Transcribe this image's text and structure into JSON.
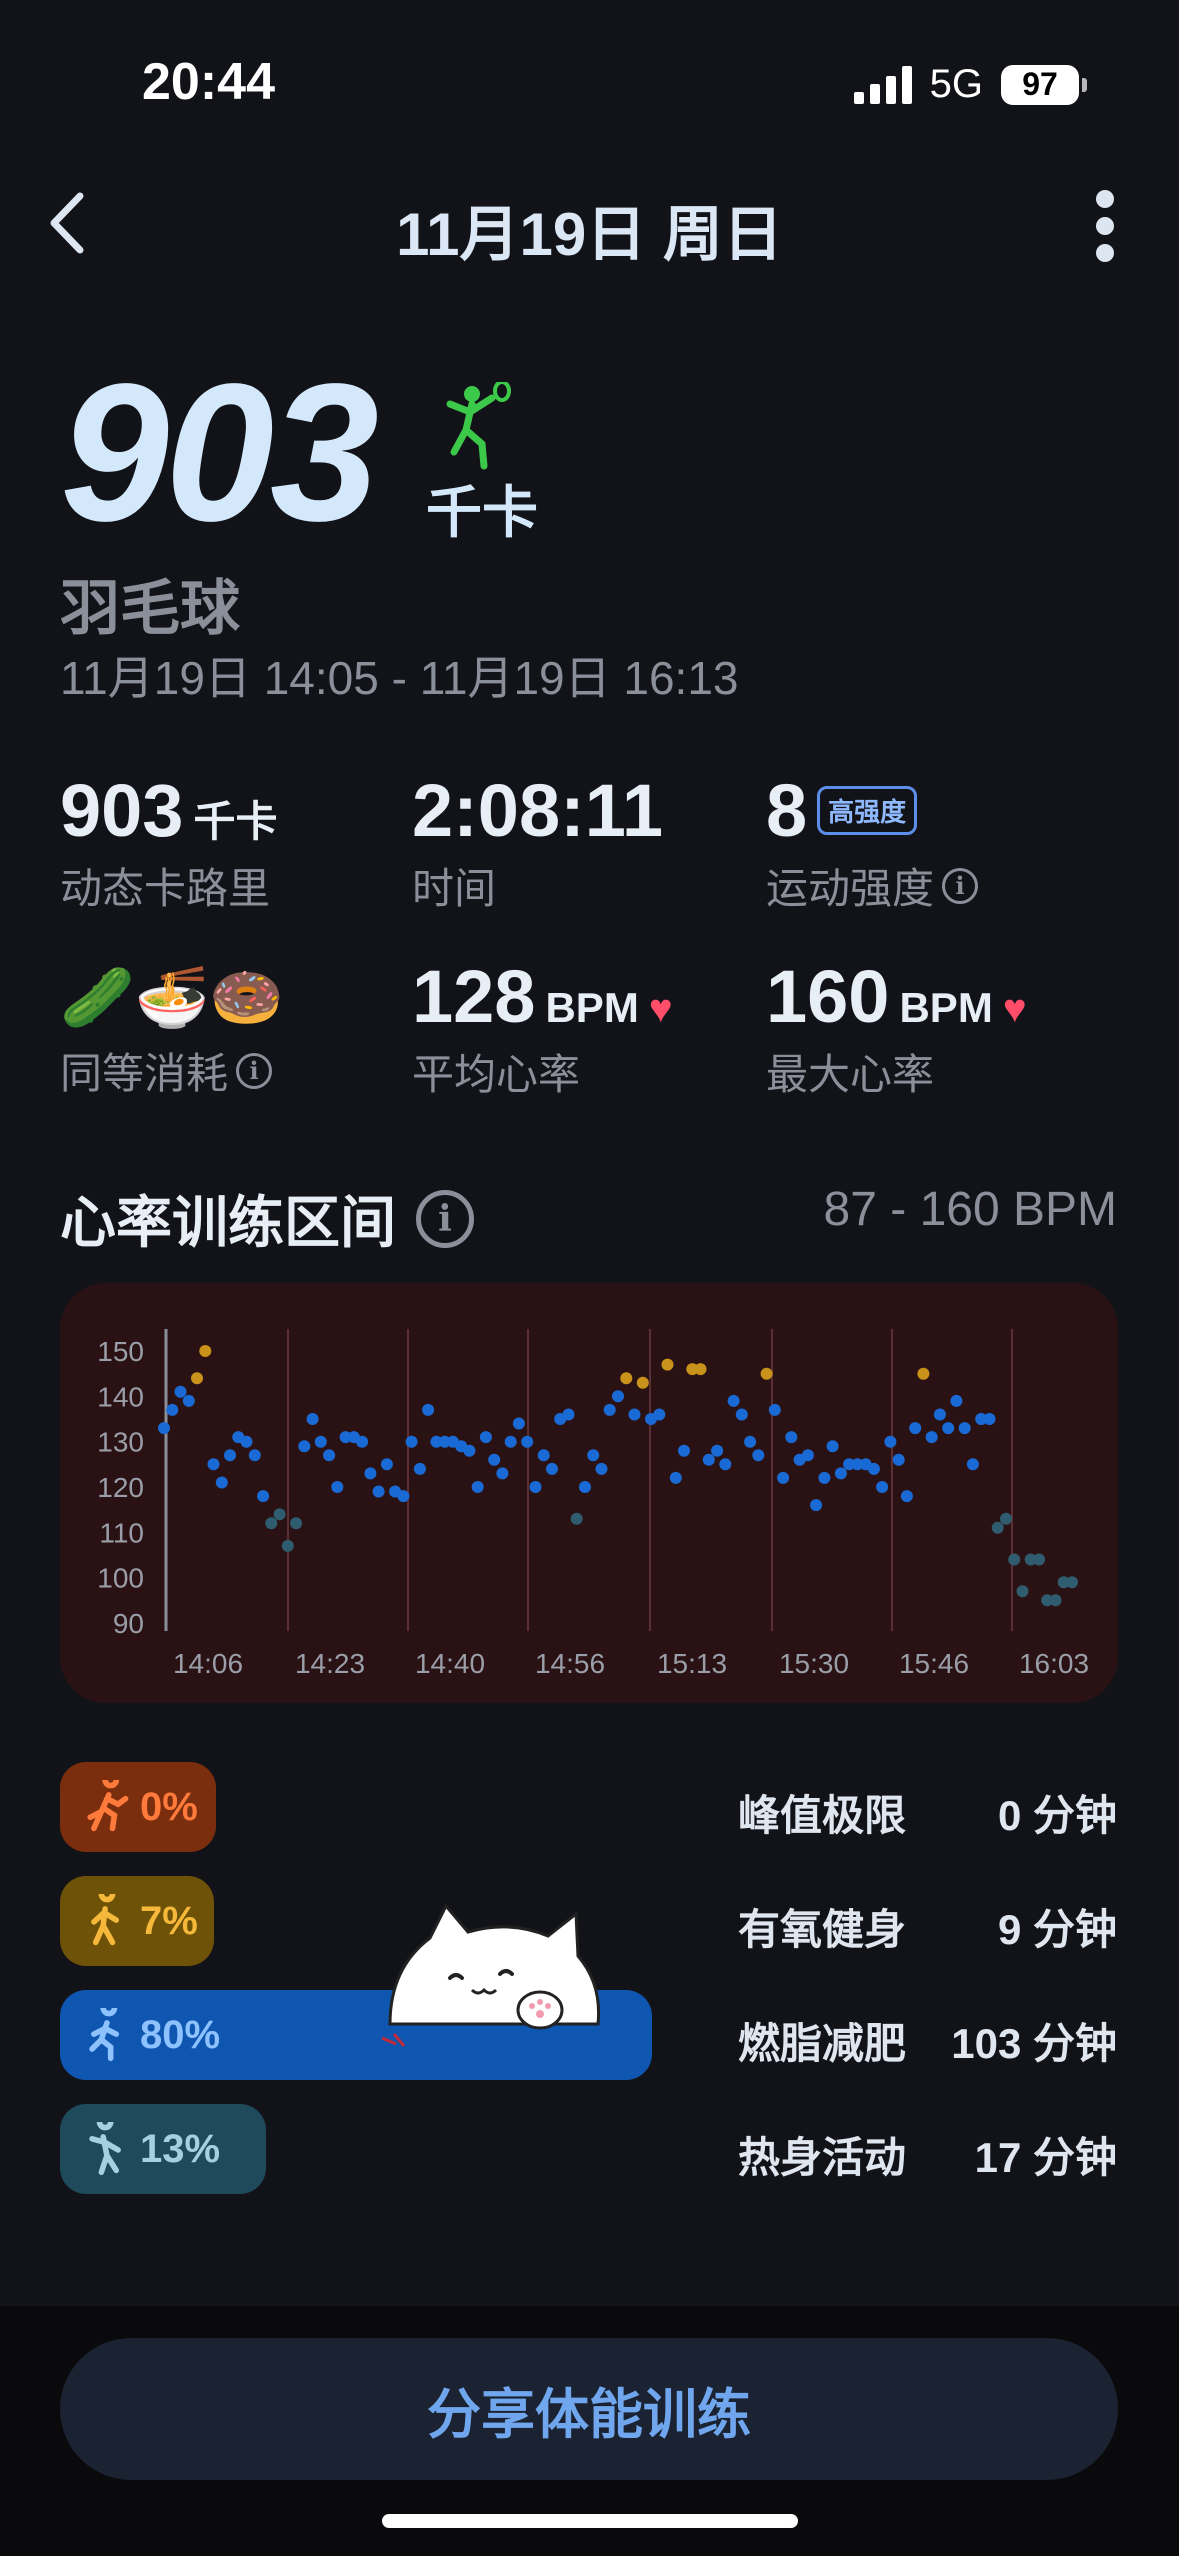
{
  "status": {
    "time": "20:44",
    "network": "5G",
    "battery": "97"
  },
  "nav": {
    "title": "11月19日 周日"
  },
  "hero": {
    "calories": "903",
    "unit": "千卡",
    "sport": "羽毛球",
    "time_range": "11月19日 14:05 - 11月19日 16:13"
  },
  "stats": {
    "active_cal": {
      "value": "903",
      "unit": "千卡",
      "label": "动态卡路里"
    },
    "duration": {
      "value": "2:08:11",
      "label": "时间"
    },
    "intensity": {
      "value": "8",
      "badge": "高强度",
      "label": "运动强度"
    },
    "equivalent": {
      "emojis": "🥒🍜🍩",
      "label": "同等消耗"
    },
    "avg_hr": {
      "value": "128",
      "unit": "BPM",
      "label": "平均心率"
    },
    "max_hr": {
      "value": "160",
      "unit": "BPM",
      "label": "最大心率"
    }
  },
  "zones": {
    "title": "心率训练区间",
    "range": "87 - 160 BPM",
    "items": [
      {
        "pct": "0%",
        "label": "峰值极限",
        "value": "0 分钟",
        "bg": "#7a2e0e",
        "fg": "#ff7a3b",
        "fraction": 0.0
      },
      {
        "pct": "7%",
        "label": "有氧健身",
        "value": "9 分钟",
        "bg": "#6e5208",
        "fg": "#f5b83a",
        "fraction": 0.07
      },
      {
        "pct": "80%",
        "label": "燃脂减肥",
        "value": "103 分钟",
        "bg": "#0e56b0",
        "fg": "#8ec2ff",
        "fraction": 0.8
      },
      {
        "pct": "13%",
        "label": "热身活动",
        "value": "17 分钟",
        "bg": "#1f4a5c",
        "fg": "#a6cfe0",
        "fraction": 0.13
      }
    ]
  },
  "chart_data": {
    "type": "scatter",
    "title": "",
    "xlabel": "",
    "ylabel": "",
    "ylim": [
      90,
      150
    ],
    "y_ticks": [
      "150",
      "140",
      "130",
      "120",
      "110",
      "100",
      "90"
    ],
    "x_ticks": [
      "14:06",
      "14:23",
      "14:40",
      "14:56",
      "15:13",
      "15:30",
      "15:46",
      "16:03"
    ],
    "x_range_minutes": [
      0,
      128
    ],
    "series": [
      {
        "points": [
          [
            0,
            133
          ],
          [
            1,
            137
          ],
          [
            2,
            141
          ],
          [
            3,
            139
          ],
          [
            4,
            144
          ],
          [
            5,
            150
          ],
          [
            7,
            125
          ],
          [
            8,
            121
          ],
          [
            9,
            127
          ],
          [
            10,
            131
          ],
          [
            11,
            130
          ],
          [
            12,
            127
          ],
          [
            13,
            118
          ],
          [
            14,
            112
          ],
          [
            15,
            114
          ],
          [
            16,
            107
          ],
          [
            17,
            112
          ],
          [
            18,
            129
          ],
          [
            19,
            135
          ],
          [
            20,
            130
          ],
          [
            21,
            127
          ],
          [
            22,
            120
          ],
          [
            23,
            131
          ],
          [
            24,
            131
          ],
          [
            25,
            130
          ],
          [
            26,
            123
          ],
          [
            27,
            119
          ],
          [
            28,
            125
          ],
          [
            29,
            119
          ],
          [
            30,
            118
          ],
          [
            31,
            130
          ],
          [
            32,
            124
          ],
          [
            33,
            137
          ],
          [
            34,
            130
          ],
          [
            35,
            130
          ],
          [
            36,
            130
          ],
          [
            37,
            129
          ],
          [
            38,
            128
          ],
          [
            39,
            120
          ],
          [
            40,
            131
          ],
          [
            41,
            126
          ],
          [
            42,
            123
          ],
          [
            43,
            130
          ],
          [
            44,
            134
          ],
          [
            45,
            130
          ],
          [
            46,
            120
          ],
          [
            47,
            127
          ],
          [
            48,
            124
          ],
          [
            49,
            135
          ],
          [
            50,
            136
          ],
          [
            51,
            113
          ],
          [
            52,
            120
          ],
          [
            53,
            127
          ],
          [
            54,
            124
          ],
          [
            55,
            137
          ],
          [
            56,
            140
          ],
          [
            57,
            144
          ],
          [
            58,
            136
          ],
          [
            59,
            143
          ],
          [
            60,
            135
          ],
          [
            61,
            136
          ],
          [
            62,
            147
          ],
          [
            63,
            122
          ],
          [
            64,
            128
          ],
          [
            65,
            146
          ],
          [
            66,
            146
          ],
          [
            67,
            126
          ],
          [
            68,
            128
          ],
          [
            69,
            125
          ],
          [
            70,
            139
          ],
          [
            71,
            136
          ],
          [
            72,
            130
          ],
          [
            73,
            127
          ],
          [
            74,
            145
          ],
          [
            75,
            137
          ],
          [
            76,
            122
          ],
          [
            77,
            131
          ],
          [
            78,
            126
          ],
          [
            79,
            127
          ],
          [
            80,
            116
          ],
          [
            81,
            122
          ],
          [
            82,
            129
          ],
          [
            83,
            123
          ],
          [
            84,
            125
          ],
          [
            85,
            125
          ],
          [
            86,
            125
          ],
          [
            87,
            124
          ],
          [
            88,
            120
          ],
          [
            89,
            130
          ],
          [
            90,
            126
          ],
          [
            91,
            118
          ],
          [
            92,
            133
          ],
          [
            93,
            145
          ],
          [
            94,
            131
          ],
          [
            95,
            136
          ],
          [
            96,
            133
          ],
          [
            97,
            139
          ],
          [
            98,
            133
          ],
          [
            99,
            125
          ],
          [
            100,
            135
          ],
          [
            101,
            135
          ],
          [
            102,
            111
          ],
          [
            103,
            113
          ],
          [
            104,
            104
          ],
          [
            105,
            97
          ],
          [
            106,
            104
          ],
          [
            107,
            104
          ],
          [
            108,
            95
          ],
          [
            109,
            95
          ],
          [
            110,
            99
          ],
          [
            111,
            99
          ]
        ]
      }
    ],
    "thresholds": {
      "aerobic_above": 142,
      "warmup_below": 115
    },
    "colors": {
      "fat_burn": "#1a6ad6",
      "aerobic": "#c9921a",
      "warmup": "#2f5c6e",
      "background": "#2a1214"
    }
  },
  "bottom": {
    "share_label": "分享体能训练"
  }
}
